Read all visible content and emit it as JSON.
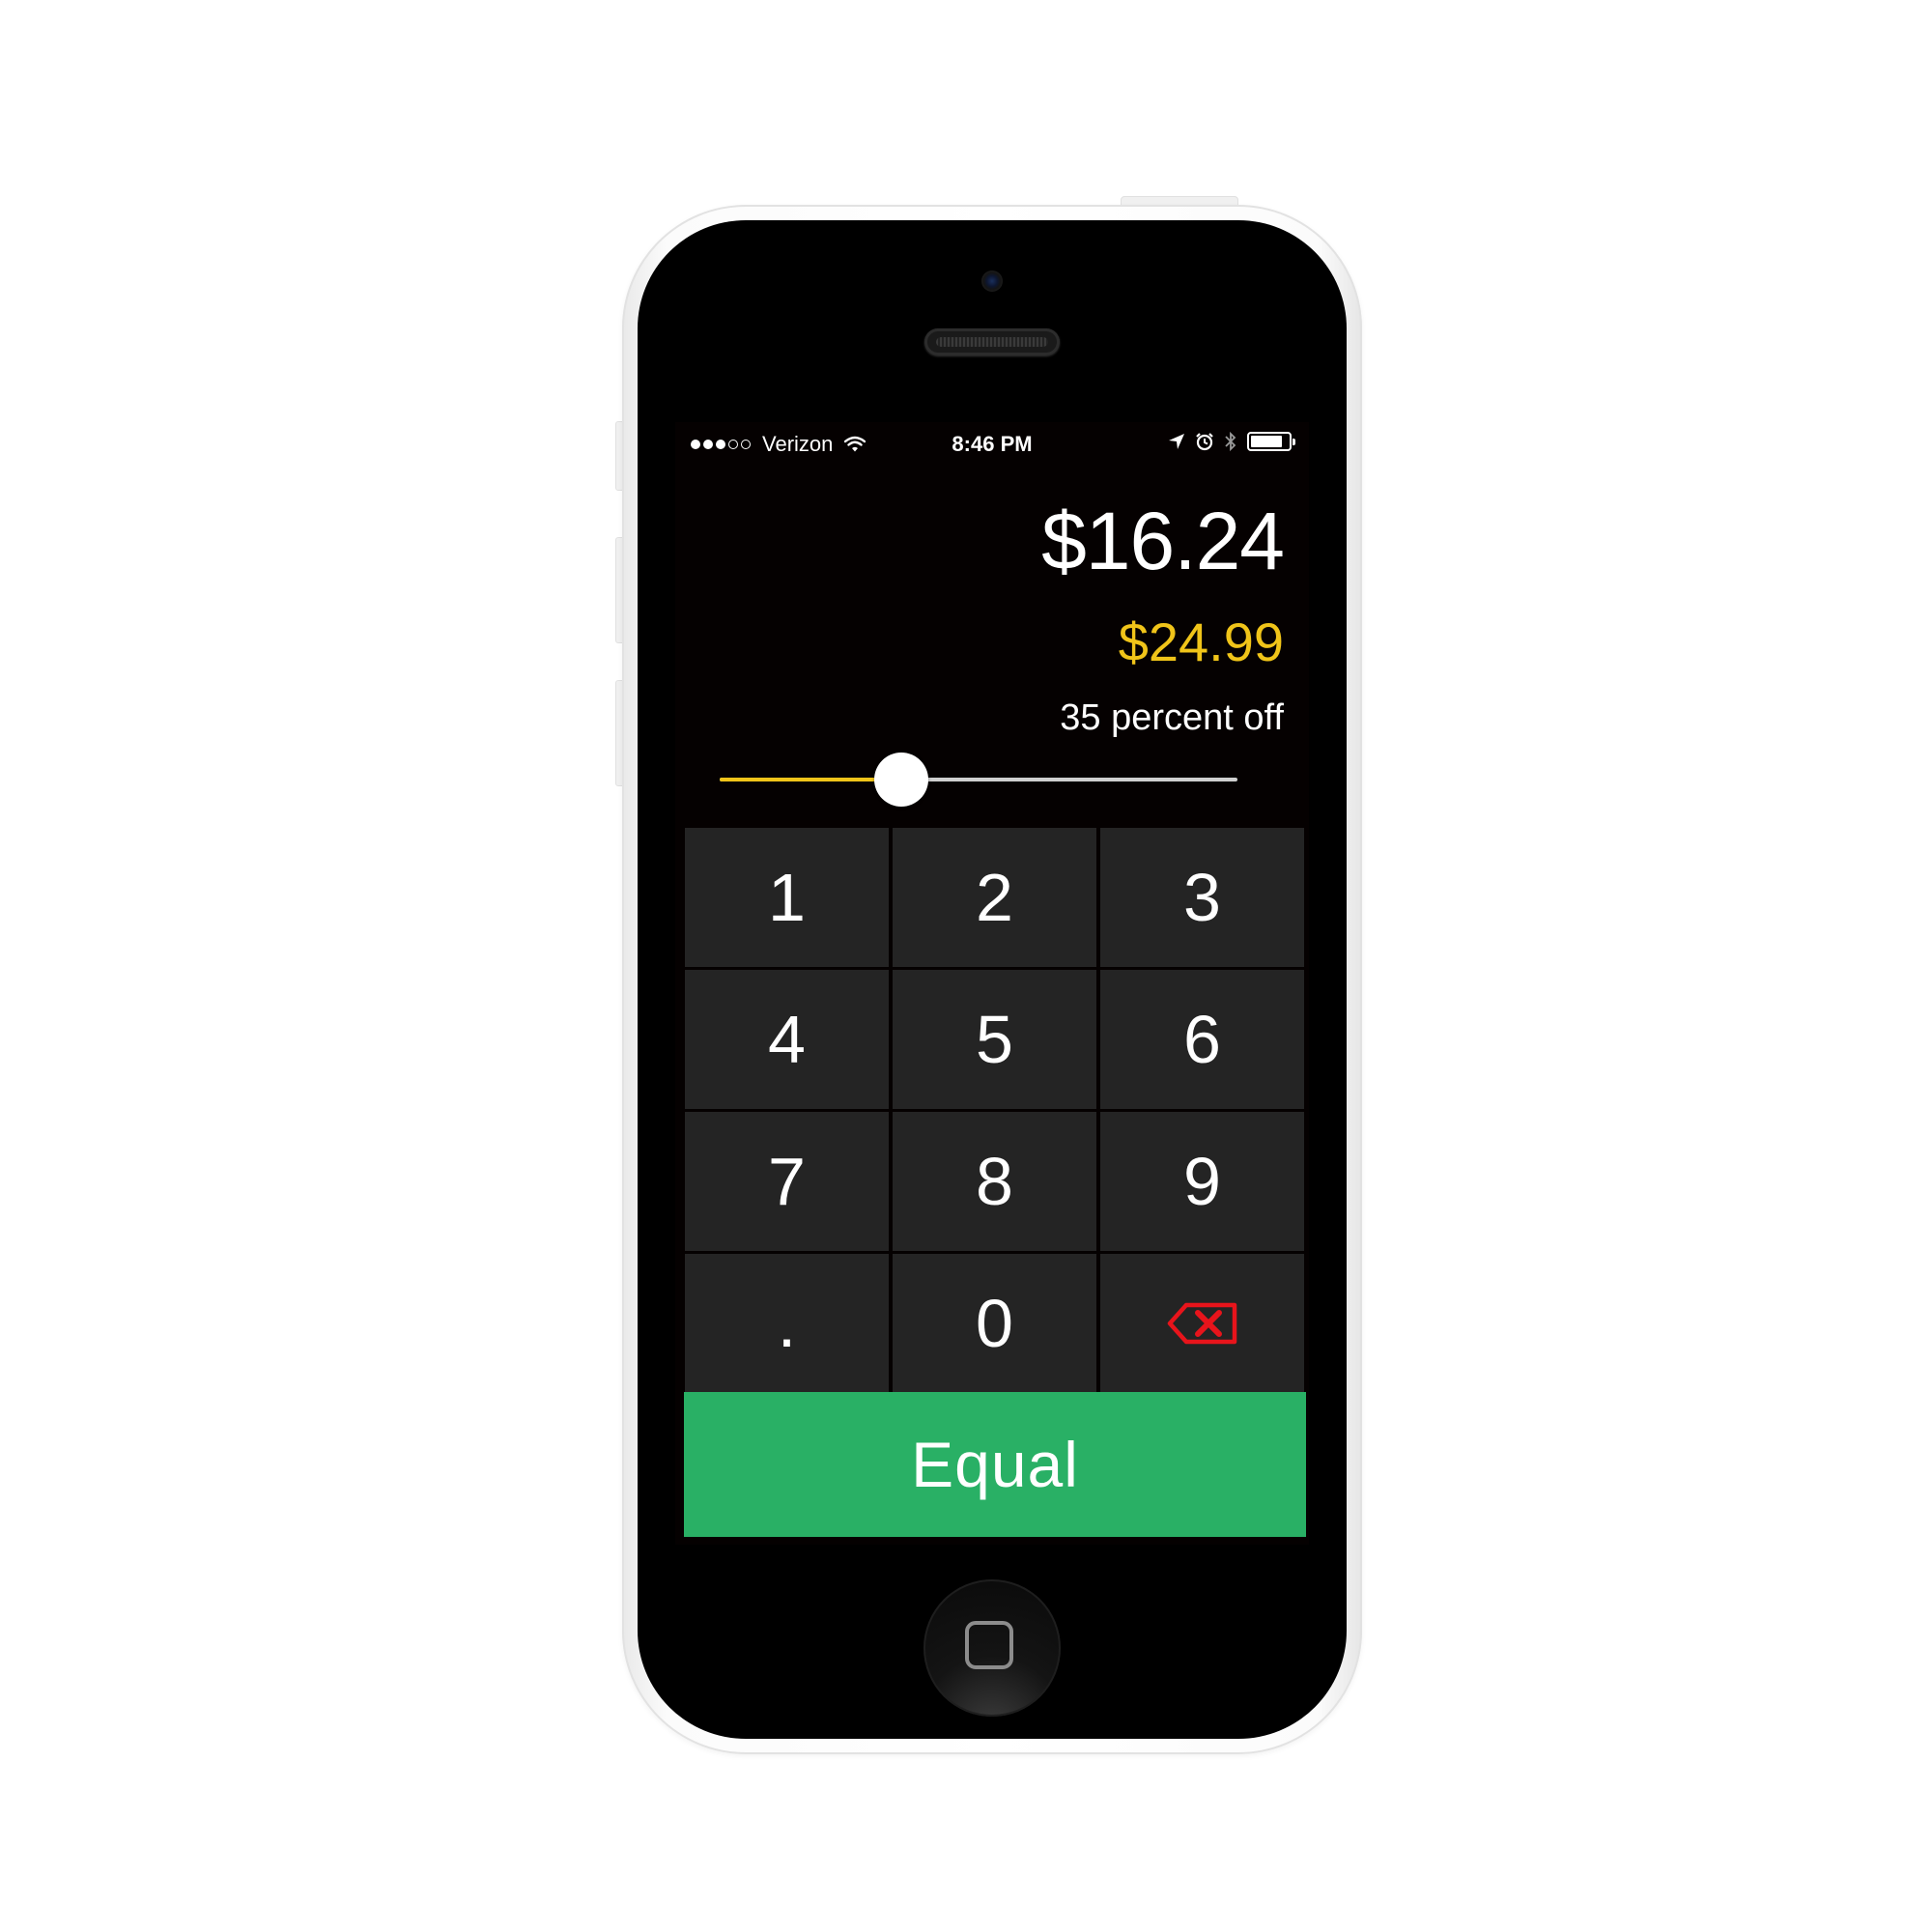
{
  "status_bar": {
    "signal_bars": 3,
    "signal_total": 5,
    "carrier": "Verizon",
    "time": "8:46 PM",
    "battery_level": 0.85
  },
  "calculator": {
    "discounted_price": "$16.24",
    "original_price": "$24.99",
    "discount_label": "35 percent off",
    "discount_percent": 35,
    "slider": {
      "min": 0,
      "max": 100,
      "value": 35
    }
  },
  "keypad": {
    "keys": [
      "1",
      "2",
      "3",
      "4",
      "5",
      "6",
      "7",
      "8",
      "9",
      ".",
      "0"
    ],
    "backspace_icon": "backspace-icon"
  },
  "equal_button": {
    "label": "Equal"
  },
  "colors": {
    "accent_yellow": "#f0c419",
    "equal_green": "#29b065",
    "backspace_red": "#e8141b",
    "key_background": "#242424",
    "screen_background": "#050101"
  }
}
